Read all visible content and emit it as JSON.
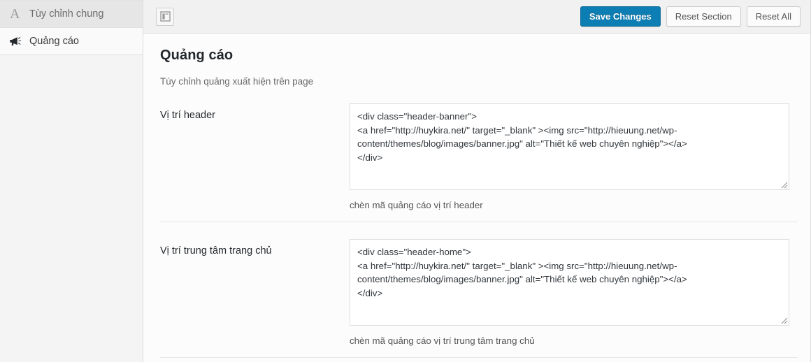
{
  "sidebar": {
    "items": [
      {
        "label": "Tùy chỉnh chung",
        "icon": "typography-icon",
        "active": true
      },
      {
        "label": "Quảng cáo",
        "icon": "megaphone-icon",
        "active": false
      }
    ]
  },
  "toolbar": {
    "expand_icon": "panel-layout-icon",
    "save_label": "Save Changes",
    "reset_section_label": "Reset Section",
    "reset_all_label": "Reset All",
    "primary_color": "#0c7eb4"
  },
  "main": {
    "title": "Quảng cáo",
    "subtitle": "Tùy chỉnh quảng xuất hiện trên page",
    "fields": [
      {
        "label": "Vị trí header",
        "value": "<div class=\"header-banner\">\n<a href=\"http://huykira.net/\" target=\"_blank\" ><img src=\"http://hieuung.net/wp-content/themes/blog/images/banner.jpg\" alt=\"Thiết kế web chuyên nghiệp\"></a>\n</div>",
        "placeholder": "",
        "hint": "chèn mã quảng cáo vị trí header"
      },
      {
        "label": "Vị trí trung tâm trang chủ",
        "value": "<div class=\"header-home\">\n<a href=\"http://huykira.net/\" target=\"_blank\" ><img src=\"http://hieuung.net/wp-content/themes/blog/images/banner.jpg\" alt=\"Thiết kế web chuyên nghiệp\"></a>\n</div>",
        "placeholder": "",
        "hint": "chèn mã quảng cáo vị trí trung tâm trang chủ"
      }
    ]
  }
}
